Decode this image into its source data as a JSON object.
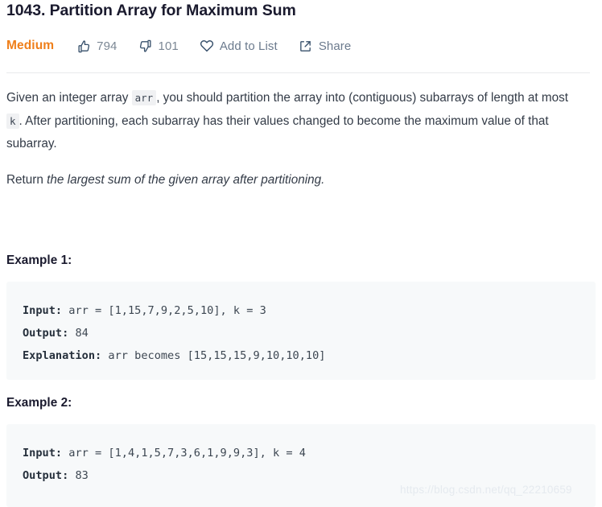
{
  "header": {
    "title": "1043. Partition Array for Maximum Sum",
    "difficulty": "Medium",
    "difficulty_color": "#ef7f1a",
    "actions": [
      {
        "icon": "thumbs-up-icon",
        "label": "794"
      },
      {
        "icon": "thumbs-down-icon",
        "label": "101"
      },
      {
        "icon": "heart-icon",
        "label": "Add to List"
      },
      {
        "icon": "share-icon",
        "label": "Share"
      }
    ]
  },
  "description": {
    "paragraph_1": {
      "part_1": "Given an integer array",
      "code_1": "arr",
      "part_2": ", you should partition the array into (contiguous) subarrays of length at most",
      "code_2": "k",
      "part_3": ". After partitioning, each subarray has their values changed to become the maximum value of that subarray."
    },
    "paragraph_2": {
      "lead": "Return ",
      "italic": "the largest sum of the given array after partitioning."
    }
  },
  "examples": [
    {
      "heading": "Example 1:",
      "lines": [
        {
          "label": "Input:",
          "value": " arr = [1,15,7,9,2,5,10], k = 3"
        },
        {
          "label": "Output:",
          "value": " 84"
        },
        {
          "label": "Explanation:",
          "value": " arr becomes [15,15,15,9,10,10,10]"
        }
      ]
    },
    {
      "heading": "Example 2:",
      "lines": [
        {
          "label": "Input:",
          "value": " arr = [1,4,1,5,7,3,6,1,9,9,3], k = 4"
        },
        {
          "label": "Output:",
          "value": " 83"
        }
      ]
    }
  ],
  "watermark": "https://blog.csdn.net/qq_22210659"
}
